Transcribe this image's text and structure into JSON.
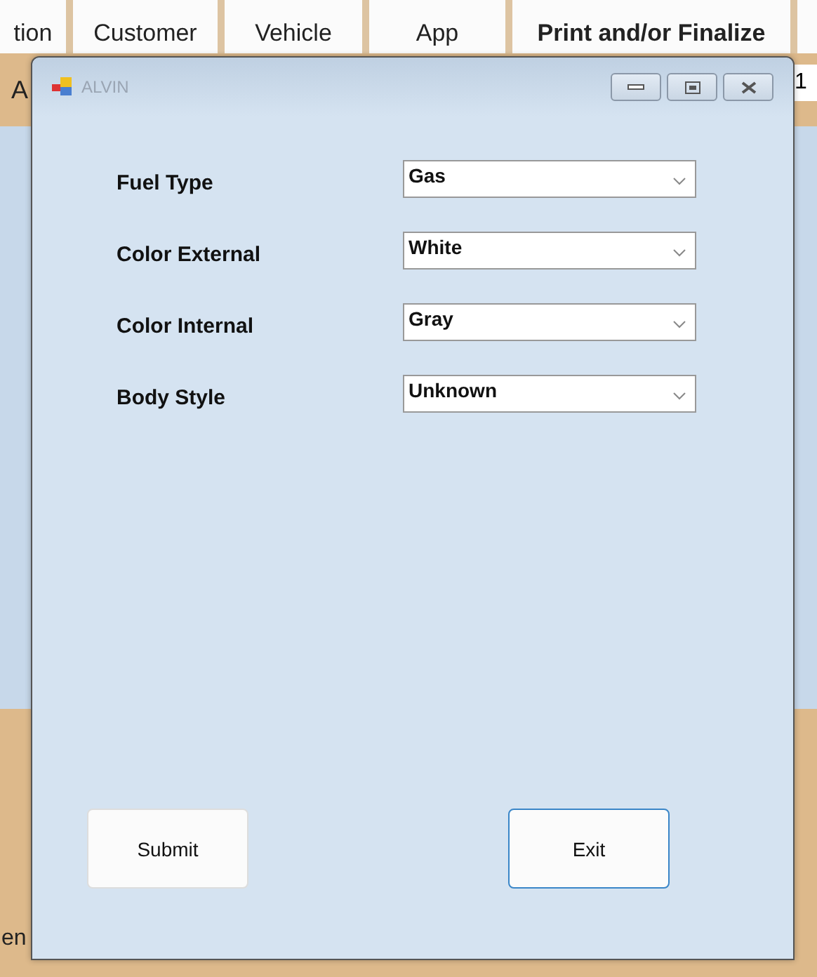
{
  "background_app": {
    "tabs": [
      {
        "label": "tion",
        "selected": false
      },
      {
        "label": "Customer",
        "selected": false
      },
      {
        "label": "Vehicle",
        "selected": false
      },
      {
        "label": "App",
        "selected": false
      },
      {
        "label": "Print and/or Finalize",
        "selected": true
      }
    ],
    "left_label_top": "A",
    "right_field_value": "1",
    "left_label_bottom": "en"
  },
  "dialog": {
    "title": "ALVIN",
    "fields": [
      {
        "label": "Fuel Type",
        "value": "Gas"
      },
      {
        "label": "Color External",
        "value": "White"
      },
      {
        "label": "Color Internal",
        "value": "Gray"
      },
      {
        "label": "Body Style",
        "value": "Unknown"
      }
    ],
    "buttons": [
      {
        "label": "Submit",
        "focused": false
      },
      {
        "label": "Exit",
        "focused": true
      }
    ]
  }
}
